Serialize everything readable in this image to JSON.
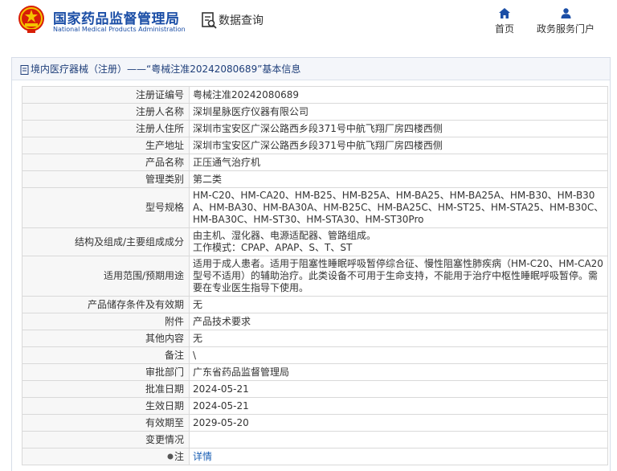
{
  "header": {
    "logo_cn": "国家药品监督管理局",
    "logo_en": "National Medical Products Administration",
    "query_label": "数据查询",
    "nav": [
      {
        "label": "首页",
        "icon": "home-icon"
      },
      {
        "label": "政务服务门户",
        "icon": "user-icon"
      }
    ]
  },
  "breadcrumb": {
    "text": "境内医疗器械（注册）——“粤械注准20242080689”基本信息"
  },
  "colors": {
    "brand_blue": "#1b4ea6",
    "link_blue": "#1a5fb4",
    "emblem_red": "#d81e06",
    "emblem_gold": "#f4c400"
  },
  "rows": [
    {
      "key": "注册证编号",
      "value": "粤械注准20242080689"
    },
    {
      "key": "注册人名称",
      "value": "深圳星脉医疗仪器有限公司"
    },
    {
      "key": "注册人住所",
      "value": "深圳市宝安区广深公路西乡段371号中航飞翔厂房四楼西侧"
    },
    {
      "key": "生产地址",
      "value": "深圳市宝安区广深公路西乡段371号中航飞翔厂房四楼西侧"
    },
    {
      "key": "产品名称",
      "value": "正压通气治疗机"
    },
    {
      "key": "管理类别",
      "value": "第二类"
    },
    {
      "key": "型号规格",
      "value": "HM-C20、HM-CA20、HM-B25、HM-B25A、HM-BA25、HM-BA25A、HM-B30、HM-B30A、HM-BA30、HM-BA30A、HM-B25C、HM-BA25C、HM-ST25、HM-STA25、HM-B30C、HM-BA30C、HM-ST30、HM-STA30、HM-ST30Pro"
    },
    {
      "key": "结构及组成/主要组成成分",
      "value_lines": [
        "由主机、湿化器、电源适配器、管路组成。",
        "工作模式：CPAP、APAP、S、T、ST"
      ]
    },
    {
      "key": "适用范围/预期用途",
      "value": "适用于成人患者。适用于阻塞性睡眠呼吸暂停综合征、慢性阻塞性肺疾病（HM-C20、HM-CA20型号不适用）的辅助治疗。此类设备不可用于生命支持，不能用于治疗中枢性睡眠呼吸暂停。需要在专业医生指导下使用。"
    },
    {
      "key": "产品储存条件及有效期",
      "value": "无"
    },
    {
      "key": "附件",
      "value": "产品技术要求"
    },
    {
      "key": "其他内容",
      "value": "无"
    },
    {
      "key": "备注",
      "value": "\\"
    },
    {
      "key": "审批部门",
      "value": "广东省药品监督管理局"
    },
    {
      "key": "批准日期",
      "value": "2024-05-21"
    },
    {
      "key": "生效日期",
      "value": "2024-05-21"
    },
    {
      "key": "有效期至",
      "value": "2029-05-20"
    },
    {
      "key": "变更情况",
      "value": ""
    },
    {
      "key": "注",
      "value": "详情",
      "key_icon": "info-dot-icon"
    }
  ]
}
